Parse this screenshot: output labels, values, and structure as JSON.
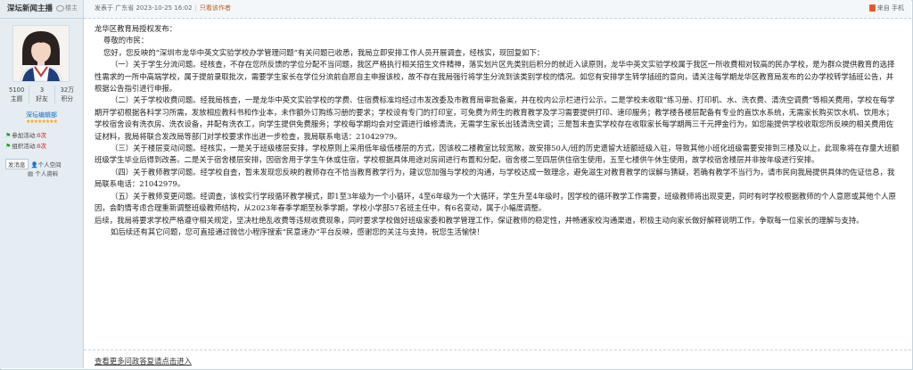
{
  "user": {
    "name": "深坛新闻主播",
    "profile_link": "楼主",
    "stats": [
      {
        "value": "5100",
        "label": "主题"
      },
      {
        "value": "3",
        "label": "好友"
      },
      {
        "value": "32万",
        "label": "积分"
      }
    ],
    "group": "深坛编辑部",
    "activity": [
      {
        "label": "参加活动:",
        "value": "0次"
      },
      {
        "label": "组织活动:",
        "value": "0次"
      }
    ],
    "buttons": {
      "message": "发消息",
      "space": "个人空间",
      "profile": "个人资料"
    }
  },
  "post": {
    "meta": {
      "posted": "发表于 广东省 2023-10-25 16:02",
      "sep": "|",
      "author_only": "只看该作者",
      "device": "来自 手机"
    },
    "paragraphs": [
      {
        "cls": "",
        "text": "龙华区教育局授权发布："
      },
      {
        "cls": "ind1",
        "text": "尊敬的市民："
      },
      {
        "cls": "ind1",
        "text": "您好，您反映的“深圳市龙华中英文实验学校办学管理问题”有关问题已收悉，我局立即安排工作人员开展调查，经核实，现回复如下："
      },
      {
        "cls": "ind2",
        "text": "（一）关于学生分流问题。经核查，不存在您所反馈的学位分配不当问题，我区严格执行相关招生文件精神，落实划片区先类别后积分的就近入读原则，龙华中英文实验学校属于我区一所收费相对较高的民办学校，是为群众提供教育的选择性需求的一所中高端学校，属于提前录取批次，需要学生家长在学位分流前自愿自主申报该校，故不存在我局强行将学生分流到该类别学校的情况。如您有安排学生转学插班的意向，请关注每学期龙华区教育局发布的公办学校转学插班公告，并根据公告指引进行申报。"
      },
      {
        "cls": "ind2",
        "text": "（二）关于学校收费问题。经我局核查，一是龙华中英文实验学校的学费、住宿费标准均经过市发改委及市教育局审批备案，并在校内公示栏进行公示，二是学校未收取“练习册、打印机、水、洗衣费、清洗空调费”等相关费用，学校在每学期开学初根据各科学习所需，发放相应教科书和作业本，未作额外订购练习册的要求；学校设有专门的打印室，可免费为师生的教育教学及学习需要提供打印、速印服务；教学楼各楼层配备有专业的直饮水系统，无需家长购买饮水机、饮用水；学校宿舍设有洗衣房、洗衣设备，并配有洗衣工，向学生提供免费服务；学校每学期均会对空调进行维修清洗，无需学生家长出钱清洗空调；三是暂未查实学校存在收取家长每学期两三千元押金行为，如您能提供学校收取您所反映的相关费用佐证材料，我局将联合发改局等部门对学校要求作出进一步检查，我局联系电话：21042979。"
      },
      {
        "cls": "ind2",
        "text": "（三）关于楼层变动问题。经核实，一是关于班级楼层安排，学校原则上采用低年级低楼层的方式，因该校二楼教室比较宽敞，故安排50人/班的历史遗留大班额班级入驻，导致其他小班化班级需要安排到三楼及以上，此现象将在存量大班额班级学生毕业后得到改善。二是关于宿舍楼层安排，因宿舍用于学生午休或住宿，学校根据具体用途对房间进行布置和分配，宿舍楼二至四层供住宿生使用，五至七楼供午休生使用，故学校宿舍楼层并非按年级进行安排。"
      },
      {
        "cls": "ind2",
        "text": "（四）关于教师教学问题。经学校自查，暂未发现您反映的教师存在不恰当教育教学行为，建议您加强与学校的沟通，与学校达成一致理念，避免滋生对教育教学的误解与猜疑，若确有教学不当行为，请市民向我局提供具体的佐证信息，我局联系电话：21042979。"
      },
      {
        "cls": "ind2",
        "text": "（五）关于教师变更问题。经调查，该校实行学段循环教学模式，即1至3年级为一个小循环，4至6年级为一个大循环，学生升至4年级时，因学校的循环教学工作需要，班级教师将出现变更，同时有时学校根据教师的个人意愿或其他个人原因，会酌情考虑合理重新调整班级教师结构，从2023年春季学期至秋季学期，学校小学部57名班主任中，有6名变动，属于小幅度调整。"
      },
      {
        "cls": "",
        "text": "后续，我局将要求学校严格遵守相关规定，坚决杜绝乱收费等违规收费现象，同时要求学校做好班级家委和教学管理工作，保证教师的稳定性，并畅通家校沟通渠道，积极主动向家长做好解释说明工作，争取每一位家长的理解与支持。"
      },
      {
        "cls": "ind2",
        "text": "如后续还有其它问题，您可直接通过微信小程序搜索“民意速办”平台反映，感谢您的关注与支持，祝您生活愉快！"
      }
    ],
    "more_link": "查看更多问政答复请点击进入"
  },
  "colors": {
    "accent": "#0e69c4",
    "border": "#c2d5e3",
    "sidebar_bg": "#e5edf2"
  }
}
